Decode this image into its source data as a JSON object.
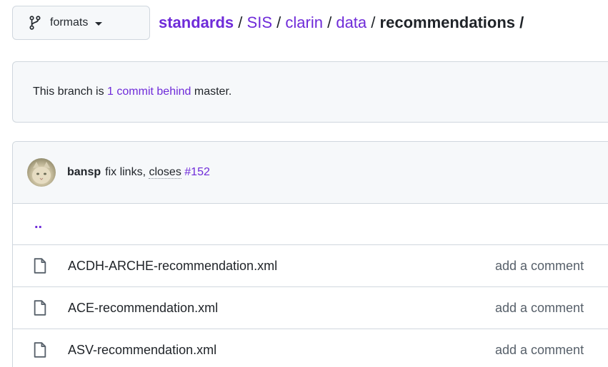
{
  "branch": {
    "name": "formats",
    "icon": "git-branch-icon"
  },
  "breadcrumb": {
    "root": "standards",
    "parts": [
      "SIS",
      "clarin",
      "data"
    ],
    "current": "recommendations",
    "separator": "/"
  },
  "branch_status": {
    "prefix": "This branch is ",
    "link": "1 commit behind",
    "suffix": " master."
  },
  "latest_commit": {
    "author": "bansp",
    "message_part1": "fix links, ",
    "message_linkish": "closes",
    "message_space": " ",
    "issue": "#152"
  },
  "parent_dir": "..",
  "files": [
    {
      "name": "ACDH-ARCHE-recommendation.xml",
      "commit": "add a comment"
    },
    {
      "name": "ACE-recommendation.xml",
      "commit": "add a comment"
    },
    {
      "name": "ASV-recommendation.xml",
      "commit": "add a comment"
    }
  ],
  "colors": {
    "link": "#6f2bd9",
    "border": "#d0d7de",
    "muted": "#57606a"
  }
}
